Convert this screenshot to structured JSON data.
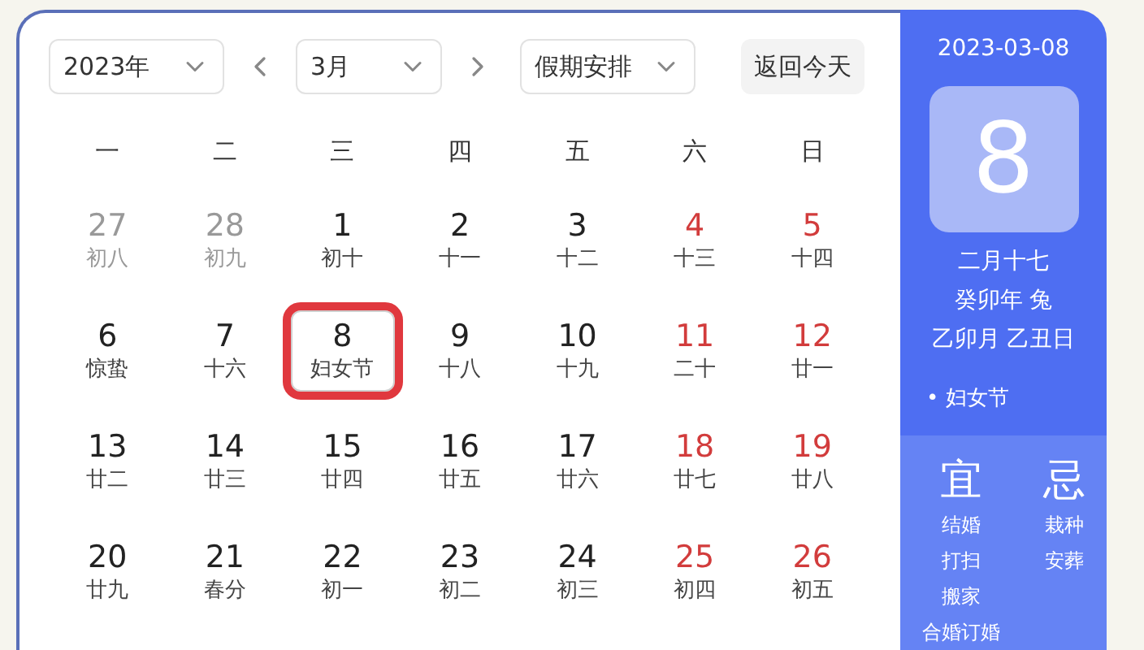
{
  "toolbar": {
    "year": "2023年",
    "month": "3月",
    "holiday": "假期安排",
    "today_button": "返回今天"
  },
  "weekdays": [
    "一",
    "二",
    "三",
    "四",
    "五",
    "六",
    "日"
  ],
  "days": [
    {
      "day": "27",
      "lunar": "初八",
      "kind": "other",
      "selected": false,
      "marked": false
    },
    {
      "day": "28",
      "lunar": "初九",
      "kind": "other",
      "selected": false,
      "marked": false
    },
    {
      "day": "1",
      "lunar": "初十",
      "kind": "normal",
      "selected": false,
      "marked": false
    },
    {
      "day": "2",
      "lunar": "十一",
      "kind": "normal",
      "selected": false,
      "marked": false
    },
    {
      "day": "3",
      "lunar": "十二",
      "kind": "normal",
      "selected": false,
      "marked": false
    },
    {
      "day": "4",
      "lunar": "十三",
      "kind": "weekend",
      "selected": false,
      "marked": false
    },
    {
      "day": "5",
      "lunar": "十四",
      "kind": "weekend",
      "selected": false,
      "marked": false
    },
    {
      "day": "6",
      "lunar": "惊蛰",
      "kind": "normal",
      "selected": false,
      "marked": false
    },
    {
      "day": "7",
      "lunar": "十六",
      "kind": "normal",
      "selected": false,
      "marked": false
    },
    {
      "day": "8",
      "lunar": "妇女节",
      "kind": "normal",
      "selected": true,
      "marked": true
    },
    {
      "day": "9",
      "lunar": "十八",
      "kind": "normal",
      "selected": false,
      "marked": false
    },
    {
      "day": "10",
      "lunar": "十九",
      "kind": "normal",
      "selected": false,
      "marked": false
    },
    {
      "day": "11",
      "lunar": "二十",
      "kind": "weekend",
      "selected": false,
      "marked": false
    },
    {
      "day": "12",
      "lunar": "廿一",
      "kind": "weekend",
      "selected": false,
      "marked": false
    },
    {
      "day": "13",
      "lunar": "廿二",
      "kind": "normal",
      "selected": false,
      "marked": false
    },
    {
      "day": "14",
      "lunar": "廿三",
      "kind": "normal",
      "selected": false,
      "marked": false
    },
    {
      "day": "15",
      "lunar": "廿四",
      "kind": "normal",
      "selected": false,
      "marked": false
    },
    {
      "day": "16",
      "lunar": "廿五",
      "kind": "normal",
      "selected": false,
      "marked": false
    },
    {
      "day": "17",
      "lunar": "廿六",
      "kind": "normal",
      "selected": false,
      "marked": false
    },
    {
      "day": "18",
      "lunar": "廿七",
      "kind": "weekend",
      "selected": false,
      "marked": false
    },
    {
      "day": "19",
      "lunar": "廿八",
      "kind": "weekend",
      "selected": false,
      "marked": false
    },
    {
      "day": "20",
      "lunar": "廿九",
      "kind": "normal",
      "selected": false,
      "marked": false
    },
    {
      "day": "21",
      "lunar": "春分",
      "kind": "normal",
      "selected": false,
      "marked": false
    },
    {
      "day": "22",
      "lunar": "初一",
      "kind": "normal",
      "selected": false,
      "marked": false
    },
    {
      "day": "23",
      "lunar": "初二",
      "kind": "normal",
      "selected": false,
      "marked": false
    },
    {
      "day": "24",
      "lunar": "初三",
      "kind": "normal",
      "selected": false,
      "marked": false
    },
    {
      "day": "25",
      "lunar": "初四",
      "kind": "weekend",
      "selected": false,
      "marked": false
    },
    {
      "day": "26",
      "lunar": "初五",
      "kind": "weekend",
      "selected": false,
      "marked": false
    }
  ],
  "detail": {
    "date": "2023-03-08",
    "big_day": "8",
    "lunar_lines": [
      "二月十七",
      "癸卯年 兔",
      "乙卯月 乙丑日"
    ],
    "festival": "• 妇女节",
    "good": {
      "title": "宜",
      "items": [
        "结婚",
        "打扫",
        "搬家",
        "合婚订婚"
      ]
    },
    "bad": {
      "title": "忌",
      "items": [
        "栽种",
        "安葬"
      ]
    }
  }
}
